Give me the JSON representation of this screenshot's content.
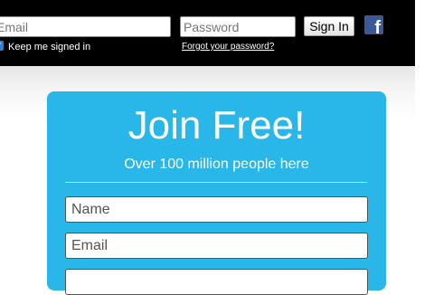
{
  "header": {
    "email_placeholder": "Email",
    "password_placeholder": "Password",
    "signin_label": "Sign In",
    "facebook_glyph": "f",
    "keep_signed_in_label": "Keep me signed in",
    "keep_signed_in_checked": true,
    "forgot_password_label": "Forgot your password?"
  },
  "signup": {
    "title": "Join Free!",
    "subtitle": "Over 100 million people here",
    "name_placeholder": "Name",
    "email_placeholder": "Email",
    "third_placeholder": ""
  },
  "colors": {
    "topbar": "#000000",
    "card": "#29b6e8",
    "facebook": "#3b5998"
  },
  "icons": [
    "facebook-icon",
    "checkbox-check-icon"
  ]
}
